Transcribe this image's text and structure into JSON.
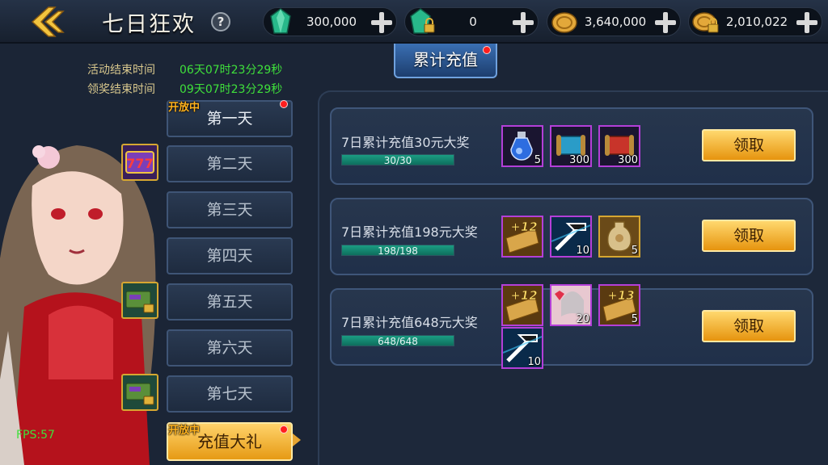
{
  "header": {
    "title": "七日狂欢",
    "help_label": "?",
    "resources": [
      {
        "name": "green-gem",
        "value": "300,000",
        "color": "#2cc99a"
      },
      {
        "name": "locked-gem",
        "value": "0",
        "color": "#2cc99a"
      },
      {
        "name": "gold-coin",
        "value": "3,640,000",
        "color": "#e3a83a"
      },
      {
        "name": "locked-coin",
        "value": "2,010,022",
        "color": "#e3a83a"
      }
    ]
  },
  "countdown": {
    "activity_label": "活动结束时间",
    "activity_value": "06天07时23分29秒",
    "reward_label": "领奖结束时间",
    "reward_value": "09天07时23分29秒"
  },
  "tab": {
    "label": "累计充值"
  },
  "open_tag": "开放中",
  "days": [
    {
      "label": "第一天",
      "open": true,
      "dot": true
    },
    {
      "label": "第二天"
    },
    {
      "label": "第三天"
    },
    {
      "label": "第四天"
    },
    {
      "label": "第五天"
    },
    {
      "label": "第六天"
    },
    {
      "label": "第七天"
    }
  ],
  "gift_button": {
    "label": "充值大礼",
    "open": true
  },
  "fps": "FPS:57",
  "rewards": [
    {
      "title": "7日累计充值30元大奖",
      "progress_text": "30/30",
      "progress": 1.0,
      "claim_label": "领取",
      "items": [
        {
          "icon": "blue-potion-icon",
          "count": "5"
        },
        {
          "icon": "blue-scroll-icon",
          "count": "300"
        },
        {
          "icon": "red-scroll-icon",
          "count": "300"
        }
      ]
    },
    {
      "title": "7日累计充值198元大奖",
      "progress_text": "198/198",
      "progress": 1.0,
      "claim_label": "领取",
      "items": [
        {
          "icon": "plus12-scroll-icon",
          "count": "",
          "badge": "+12"
        },
        {
          "icon": "hammer-icon",
          "count": "10"
        },
        {
          "icon": "gold-vase-icon",
          "count": "5"
        }
      ]
    },
    {
      "title": "7日累计充值648元大奖",
      "progress_text": "648/648",
      "progress": 1.0,
      "claim_label": "领取",
      "items": [
        {
          "icon": "plus12-scroll-icon",
          "count": "",
          "badge": "+12"
        },
        {
          "icon": "character-card-icon",
          "count": "20"
        },
        {
          "icon": "plus13-scroll-icon",
          "count": "5",
          "badge": "+13"
        },
        {
          "icon": "hammer-icon",
          "count": "10"
        }
      ]
    }
  ]
}
